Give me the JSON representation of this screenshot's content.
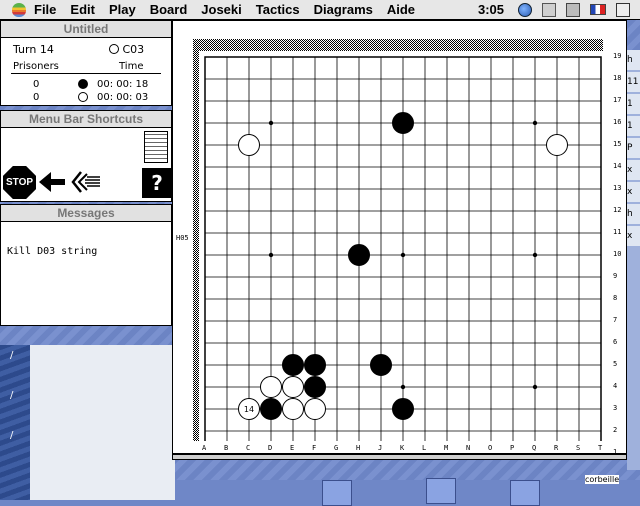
{
  "menubar": {
    "items": [
      "File",
      "Edit",
      "Play",
      "Board",
      "Joseki",
      "Tactics",
      "Diagrams",
      "Aide"
    ],
    "clock": "3:05"
  },
  "info_panel": {
    "title": "Untitled",
    "turn_label": "Turn 14",
    "to_play": "C03",
    "prisoners_label": "Prisoners",
    "time_label": "Time",
    "black_prisoners": "0",
    "white_prisoners": "0",
    "black_time": "00: 00: 18",
    "white_time": "00: 00: 03"
  },
  "shortcuts_panel": {
    "title": "Menu Bar Shortcuts",
    "stop_label": "STOP",
    "help_label": "?"
  },
  "messages_panel": {
    "title": "Messages",
    "text": "Kill D03 string"
  },
  "board": {
    "size": 19,
    "columns": [
      "A",
      "B",
      "C",
      "D",
      "E",
      "F",
      "G",
      "H",
      "J",
      "K",
      "L",
      "M",
      "N",
      "O",
      "P",
      "Q",
      "R",
      "S",
      "T"
    ],
    "rows": [
      "19",
      "18",
      "17",
      "16",
      "15",
      "14",
      "13",
      "12",
      "11",
      "10",
      "9",
      "8",
      "7",
      "6",
      "5",
      "4",
      "3",
      "2",
      "1"
    ],
    "last_move_label": "H05",
    "move_number_label": "14",
    "stones": [
      {
        "color": "black",
        "col": "K",
        "row": 16
      },
      {
        "color": "white",
        "col": "C",
        "row": 15
      },
      {
        "color": "white",
        "col": "R",
        "row": 15
      },
      {
        "color": "black",
        "col": "H",
        "row": 10
      },
      {
        "color": "black",
        "col": "E",
        "row": 5
      },
      {
        "color": "black",
        "col": "F",
        "row": 5
      },
      {
        "color": "white",
        "col": "D",
        "row": 4
      },
      {
        "color": "white",
        "col": "E",
        "row": 4
      },
      {
        "color": "black",
        "col": "F",
        "row": 4
      },
      {
        "color": "black",
        "col": "J",
        "row": 5
      },
      {
        "color": "white",
        "col": "C",
        "row": 3
      },
      {
        "color": "black",
        "col": "D",
        "row": 3
      },
      {
        "color": "white",
        "col": "E",
        "row": 3
      },
      {
        "color": "white",
        "col": "F",
        "row": 3
      },
      {
        "color": "black",
        "col": "K",
        "row": 3
      }
    ],
    "numbered_stone": {
      "col": "C",
      "row": 3
    }
  },
  "desktop": {
    "right_labels": [
      "h",
      "11",
      "1",
      "1",
      "P",
      "x",
      "x",
      "h",
      "x"
    ],
    "corner_label": "corbeille"
  }
}
